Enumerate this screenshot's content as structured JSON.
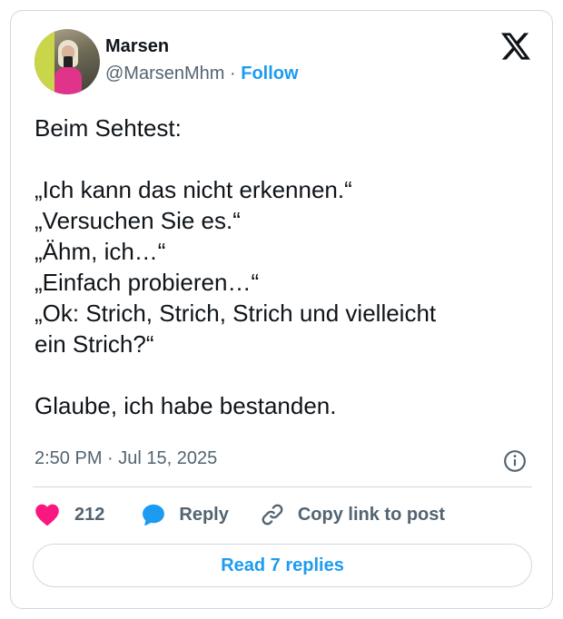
{
  "author": {
    "name": "Marsen",
    "handle": "@MarsenMhm",
    "separator": "·",
    "follow_label": "Follow"
  },
  "tweet": {
    "lines": [
      "Beim Sehtest:",
      "„Ich kann das nicht erkennen.“",
      "„Versuchen Sie es.“",
      "„Ähm, ich…“",
      "„Einfach probieren…“",
      "„Ok: Strich, Strich, Strich und vielleicht",
      "ein Strich?“",
      "Glaube, ich habe bestanden."
    ]
  },
  "meta": {
    "timestamp": "2:50 PM · Jul 15, 2025"
  },
  "actions": {
    "like_count": "212",
    "reply_label": "Reply",
    "copy_label": "Copy link to post"
  },
  "read_replies_label": "Read 7 replies",
  "colors": {
    "accent": "#1d9bf0",
    "like": "#f91880",
    "muted": "#536471",
    "border": "#cfd9de"
  },
  "icons": [
    "x-logo-icon",
    "info-icon",
    "heart-icon",
    "reply-bubble-icon",
    "link-icon"
  ]
}
